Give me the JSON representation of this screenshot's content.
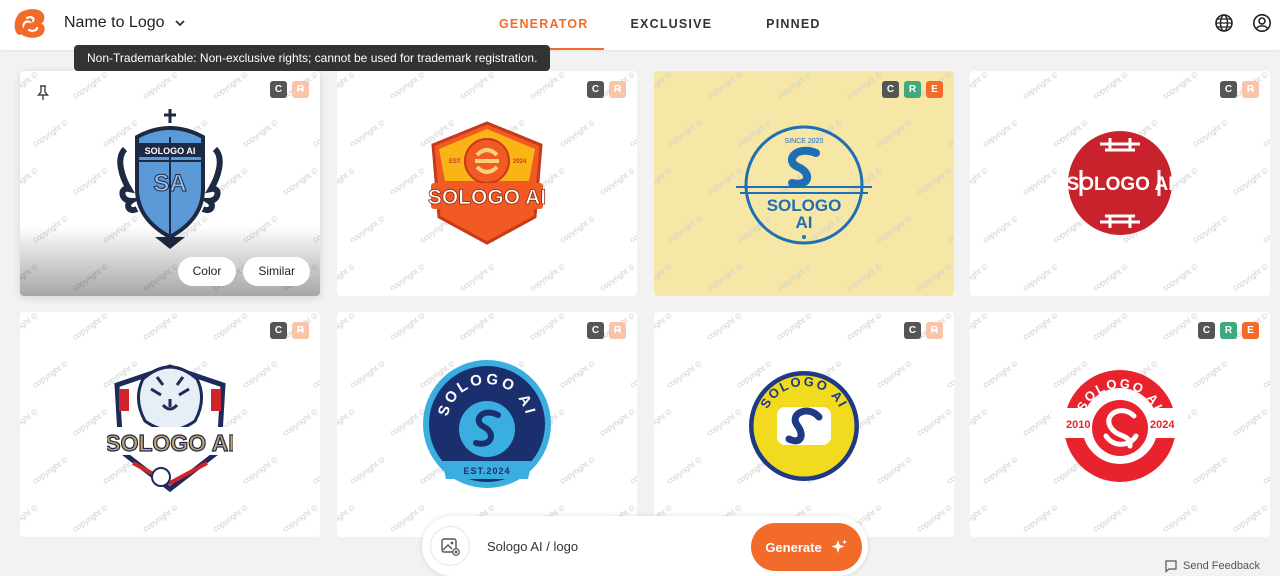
{
  "app": {
    "title": "Name to Logo",
    "brand_color": "#f26b2a"
  },
  "tabs": [
    {
      "label": "GENERATOR",
      "active": true
    },
    {
      "label": "EXCLUSIVE",
      "active": false
    },
    {
      "label": "PINNED",
      "active": false
    }
  ],
  "header_icons": [
    "globe-icon",
    "user-icon"
  ],
  "tooltip": "Non-Trademarkable: Non-exclusive rights; cannot be used for trademark registration.",
  "badge_labels": {
    "c": "C",
    "r": "R",
    "e": "E"
  },
  "card_actions": {
    "color": "Color",
    "similar": "Similar"
  },
  "cards": [
    {
      "logo_text": "SOLOGO AI",
      "monogram": "SA",
      "badges": [
        "C",
        "R-disabled"
      ],
      "hovered": true,
      "background": "#ffffff"
    },
    {
      "logo_text": "SOLOGO AI",
      "est": "EST.",
      "year": "2024",
      "badges": [
        "C",
        "R-disabled"
      ],
      "background": "#ffffff"
    },
    {
      "logo_text_1": "SOLOGO",
      "logo_text_2": "AI",
      "since": "SINCE 2020",
      "badges": [
        "C",
        "R",
        "E"
      ],
      "background": "#f7e7a7"
    },
    {
      "logo_text": "SOLOGO AI",
      "badges": [
        "C",
        "R-disabled"
      ],
      "background": "#ffffff"
    },
    {
      "logo_text": "SOLOGO AI",
      "badges": [
        "C",
        "R-disabled"
      ],
      "background": "#ffffff"
    },
    {
      "logo_text": "SOLOGO AI",
      "est": "EST.2024",
      "badges": [
        "C",
        "R-disabled"
      ],
      "background": "#ffffff"
    },
    {
      "logo_text": "SOLOGO AI",
      "badges": [
        "C",
        "R-disabled"
      ],
      "background": "#ffffff"
    },
    {
      "logo_text": "SOLOGO AI",
      "year_left": "2010",
      "year_right": "2024",
      "badges": [
        "C",
        "R",
        "E"
      ],
      "background": "#ffffff"
    }
  ],
  "prompt": {
    "text": "Sologo AI / logo",
    "generate_label": "Generate"
  },
  "feedback_label": "Send Feedback"
}
